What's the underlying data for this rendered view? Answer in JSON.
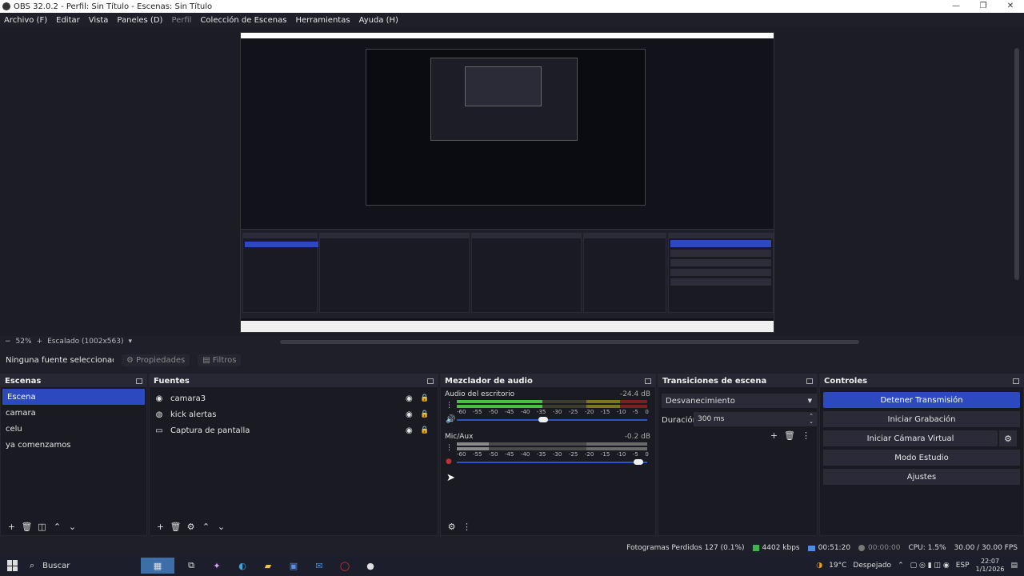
{
  "window": {
    "title": "OBS 32.0.2 - Perfil: Sin Título - Escenas: Sin Título"
  },
  "menu": [
    "Archivo (F)",
    "Editar",
    "Vista",
    "Paneles (D)",
    "Perfil",
    "Colección de Escenas",
    "Herramientas",
    "Ayuda (H)"
  ],
  "zoom": {
    "minus": "−",
    "value": "52%",
    "plus": "+",
    "scaling": "Escalado (1002x563)"
  },
  "propbar": {
    "no_selection": "Ninguna fuente seleccionada",
    "properties": "Propiedades",
    "filters": "Filtros"
  },
  "scenes": {
    "title": "Escenas",
    "items": [
      "Escena",
      "camara",
      "celu",
      "ya comenzamos"
    ]
  },
  "sources": {
    "title": "Fuentes",
    "items": [
      {
        "name": "camara3",
        "icon": "camera-icon"
      },
      {
        "name": "kick alertas",
        "icon": "globe-icon"
      },
      {
        "name": "Captura de pantalla",
        "icon": "monitor-icon"
      }
    ]
  },
  "mixer": {
    "title": "Mezclador de audio",
    "channels": [
      {
        "name": "Audio del escritorio",
        "db": "-24.4 dB",
        "level": 0.45,
        "volume": 0.45
      },
      {
        "name": "Mic/Aux",
        "db": "-0.2 dB",
        "level": 0.17,
        "volume": 0.98
      }
    ],
    "ticks": [
      "-60",
      "-55",
      "-50",
      "-45",
      "-40",
      "-35",
      "-30",
      "-25",
      "-20",
      "-15",
      "-10",
      "-5",
      "0"
    ]
  },
  "transitions": {
    "title": "Transiciones de escena",
    "selected": "Desvanecimiento",
    "duration_label": "Duración",
    "duration_value": "300 ms"
  },
  "controls": {
    "title": "Controles",
    "stop_stream": "Detener Transmisión",
    "start_rec": "Iniciar Grabación",
    "virtual_cam": "Iniciar Cámara Virtual",
    "studio": "Modo Estudio",
    "settings": "Ajustes"
  },
  "status": {
    "dropped": "Fotogramas Perdidos 127 (0.1%)",
    "bitrate": "4402 kbps",
    "stream_time": "00:51:20",
    "rec_time": "00:00:00",
    "cpu": "CPU: 1.5%",
    "fps": "30.00 / 30.00 FPS"
  },
  "taskbar": {
    "search": "Buscar",
    "weather": "19°C",
    "weather_desc": "Despejado",
    "lang": "ESP",
    "time": "22:07",
    "date": "1/1/2026"
  }
}
